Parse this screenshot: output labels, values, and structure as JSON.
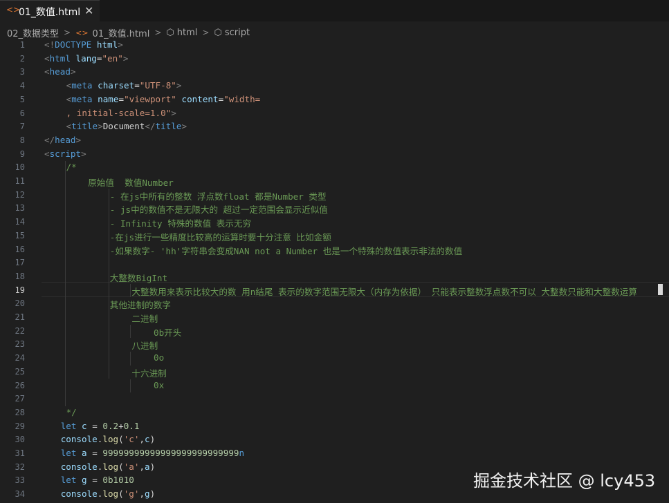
{
  "tab": {
    "icon": "<>",
    "label": "01_数值.html",
    "close": "✕"
  },
  "breadcrumb": [
    {
      "label": "02_数据类型",
      "icon": ""
    },
    {
      "label": "01_数值.html",
      "icon": "<>"
    },
    {
      "label": "html",
      "icon": "cube-icon"
    },
    {
      "label": "script",
      "icon": "cube-icon"
    }
  ],
  "editor": {
    "active_line": 19,
    "lines": [
      {
        "n": "1",
        "indent": 0,
        "tokens": [
          [
            "punc",
            "<!"
          ],
          [
            "tag",
            "DOCTYPE"
          ],
          [
            "txt",
            " "
          ],
          [
            "attr",
            "html"
          ],
          [
            "punc",
            ">"
          ]
        ]
      },
      {
        "n": "2",
        "indent": 0,
        "tokens": [
          [
            "punc",
            "<"
          ],
          [
            "tag",
            "html"
          ],
          [
            "txt",
            " "
          ],
          [
            "attr",
            "lang"
          ],
          [
            "txt",
            "="
          ],
          [
            "str",
            "\"en\""
          ],
          [
            "punc",
            ">"
          ]
        ]
      },
      {
        "n": "3",
        "indent": 0,
        "tokens": [
          [
            "punc",
            "<"
          ],
          [
            "tag",
            "head"
          ],
          [
            "punc",
            ">"
          ]
        ]
      },
      {
        "n": "4",
        "indent": 4,
        "tokens": [
          [
            "punc",
            "<"
          ],
          [
            "tag",
            "meta"
          ],
          [
            "txt",
            " "
          ],
          [
            "attr",
            "charset"
          ],
          [
            "txt",
            "="
          ],
          [
            "str",
            "\"UTF-8\""
          ],
          [
            "punc",
            ">"
          ]
        ]
      },
      {
        "n": "5",
        "indent": 4,
        "tokens": [
          [
            "punc",
            "<"
          ],
          [
            "tag",
            "meta"
          ],
          [
            "txt",
            " "
          ],
          [
            "attr",
            "name"
          ],
          [
            "txt",
            "="
          ],
          [
            "str",
            "\"viewport\""
          ],
          [
            "txt",
            " "
          ],
          [
            "attr",
            "content"
          ],
          [
            "txt",
            "="
          ],
          [
            "str",
            "\"width="
          ]
        ]
      },
      {
        "n": "6",
        "indent": 4,
        "tokens": [
          [
            "str",
            ", initial-scale=1.0\""
          ],
          [
            "punc",
            ">"
          ]
        ]
      },
      {
        "n": "7",
        "indent": 4,
        "tokens": [
          [
            "punc",
            "<"
          ],
          [
            "tag",
            "title"
          ],
          [
            "punc",
            ">"
          ],
          [
            "txt",
            "Document"
          ],
          [
            "punc",
            "</"
          ],
          [
            "tag",
            "title"
          ],
          [
            "punc",
            ">"
          ]
        ]
      },
      {
        "n": "8",
        "indent": 0,
        "tokens": [
          [
            "punc",
            "</"
          ],
          [
            "tag",
            "head"
          ],
          [
            "punc",
            ">"
          ]
        ]
      },
      {
        "n": "9",
        "indent": 0,
        "tokens": [
          [
            "punc",
            "<"
          ],
          [
            "tag",
            "script"
          ],
          [
            "punc",
            ">"
          ]
        ]
      },
      {
        "n": "10",
        "indent": 4,
        "tokens": [
          [
            "com",
            "/*"
          ]
        ]
      },
      {
        "n": "11",
        "indent": 8,
        "tokens": [
          [
            "com",
            "原始值  数值Number"
          ]
        ]
      },
      {
        "n": "12",
        "indent": 12,
        "tokens": [
          [
            "com",
            "- 在js中所有的整数 浮点数float 都是Number 类型"
          ]
        ]
      },
      {
        "n": "13",
        "indent": 12,
        "tokens": [
          [
            "com",
            "- js中的数值不是无限大的 超过一定范围会显示近似值"
          ]
        ]
      },
      {
        "n": "14",
        "indent": 12,
        "tokens": [
          [
            "com",
            "- Infinity 特殊的数值 表示无穷"
          ]
        ]
      },
      {
        "n": "15",
        "indent": 12,
        "tokens": [
          [
            "com",
            "-在js进行一些精度比较高的运算时要十分注意 比如金额"
          ]
        ]
      },
      {
        "n": "16",
        "indent": 12,
        "tokens": [
          [
            "com",
            "-如果数字- 'hh'字符串会变成NAN not a Number 也是一个特殊的数值表示非法的数值"
          ]
        ]
      },
      {
        "n": "17",
        "indent": 0,
        "tokens": []
      },
      {
        "n": "18",
        "indent": 12,
        "tokens": [
          [
            "com",
            "大整数BigInt"
          ]
        ]
      },
      {
        "n": "19",
        "indent": 16,
        "tokens": [
          [
            "com",
            "大整数用来表示比较大的数 用n结尾 表示的数字范围无限大（内存为依据） 只能表示整数浮点数不可以 大整数只能和大整数运算"
          ]
        ]
      },
      {
        "n": "20",
        "indent": 12,
        "tokens": [
          [
            "com",
            "其他进制的数字"
          ]
        ]
      },
      {
        "n": "21",
        "indent": 16,
        "tokens": [
          [
            "com",
            "二进制"
          ]
        ]
      },
      {
        "n": "22",
        "indent": 20,
        "tokens": [
          [
            "com",
            "0b开头"
          ]
        ]
      },
      {
        "n": "23",
        "indent": 16,
        "tokens": [
          [
            "com",
            "八进制"
          ]
        ]
      },
      {
        "n": "24",
        "indent": 20,
        "tokens": [
          [
            "com",
            "0o"
          ]
        ]
      },
      {
        "n": "25",
        "indent": 16,
        "tokens": [
          [
            "com",
            "十六进制"
          ]
        ]
      },
      {
        "n": "26",
        "indent": 20,
        "tokens": [
          [
            "com",
            "0x"
          ]
        ]
      },
      {
        "n": "27",
        "indent": 0,
        "tokens": []
      },
      {
        "n": "28",
        "indent": 4,
        "tokens": [
          [
            "com",
            "*/"
          ]
        ]
      },
      {
        "n": "29",
        "indent": 3,
        "tokens": [
          [
            "kw",
            "let"
          ],
          [
            "txt",
            " "
          ],
          [
            "var",
            "c"
          ],
          [
            "txt",
            " = "
          ],
          [
            "num",
            "0.2"
          ],
          [
            "txt",
            "+"
          ],
          [
            "num",
            "0.1"
          ]
        ]
      },
      {
        "n": "30",
        "indent": 3,
        "tokens": [
          [
            "var",
            "console"
          ],
          [
            "txt",
            "."
          ],
          [
            "fn",
            "log"
          ],
          [
            "txt",
            "("
          ],
          [
            "str",
            "'c'"
          ],
          [
            "txt",
            ","
          ],
          [
            "var",
            "c"
          ],
          [
            "txt",
            ")"
          ]
        ]
      },
      {
        "n": "31",
        "indent": 3,
        "tokens": [
          [
            "kw",
            "let"
          ],
          [
            "txt",
            " "
          ],
          [
            "var",
            "a"
          ],
          [
            "txt",
            " = "
          ],
          [
            "num",
            "99999999999999999999999999"
          ],
          [
            "kw",
            "n"
          ]
        ]
      },
      {
        "n": "32",
        "indent": 3,
        "tokens": [
          [
            "var",
            "console"
          ],
          [
            "txt",
            "."
          ],
          [
            "fn",
            "log"
          ],
          [
            "txt",
            "("
          ],
          [
            "str",
            "'a'"
          ],
          [
            "txt",
            ","
          ],
          [
            "var",
            "a"
          ],
          [
            "txt",
            ")"
          ]
        ]
      },
      {
        "n": "33",
        "indent": 3,
        "tokens": [
          [
            "kw",
            "let"
          ],
          [
            "txt",
            " "
          ],
          [
            "var",
            "g"
          ],
          [
            "txt",
            " = "
          ],
          [
            "num",
            "0b1010"
          ]
        ]
      },
      {
        "n": "34",
        "indent": 3,
        "tokens": [
          [
            "var",
            "console"
          ],
          [
            "txt",
            "."
          ],
          [
            "fn",
            "log"
          ],
          [
            "txt",
            "("
          ],
          [
            "str",
            "'g'"
          ],
          [
            "txt",
            ","
          ],
          [
            "var",
            "g"
          ],
          [
            "txt",
            ")"
          ]
        ]
      }
    ]
  },
  "watermark": "掘金技术社区 @ lcy453"
}
